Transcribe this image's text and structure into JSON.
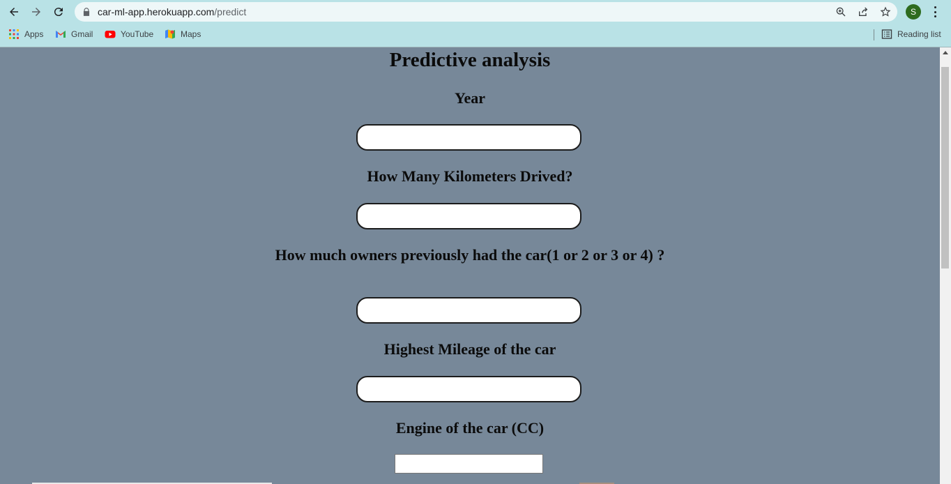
{
  "browser": {
    "url_host": "car-ml-app.herokuapp.com",
    "url_path": "/predict",
    "profile_initial": "S",
    "bookmarks": [
      {
        "label": "Apps",
        "icon": "apps-grid-icon"
      },
      {
        "label": "Gmail",
        "icon": "gmail-icon"
      },
      {
        "label": "YouTube",
        "icon": "youtube-icon"
      },
      {
        "label": "Maps",
        "icon": "maps-icon"
      }
    ],
    "reading_list": "Reading list"
  },
  "page": {
    "title": "Predictive analysis",
    "fields": [
      {
        "label": "Year",
        "value": ""
      },
      {
        "label": "How Many Kilometers Drived?",
        "value": ""
      },
      {
        "label": "How much owners previously had the car(1 or 2 or 3 or 4) ?",
        "value": ""
      },
      {
        "label": "Highest Mileage of the car",
        "value": ""
      },
      {
        "label": "Engine of the car (CC)",
        "value": ""
      }
    ]
  },
  "colors": {
    "page_background": "#778899",
    "chrome_background": "#b9e2e6",
    "avatar": "#2e6b1f"
  }
}
